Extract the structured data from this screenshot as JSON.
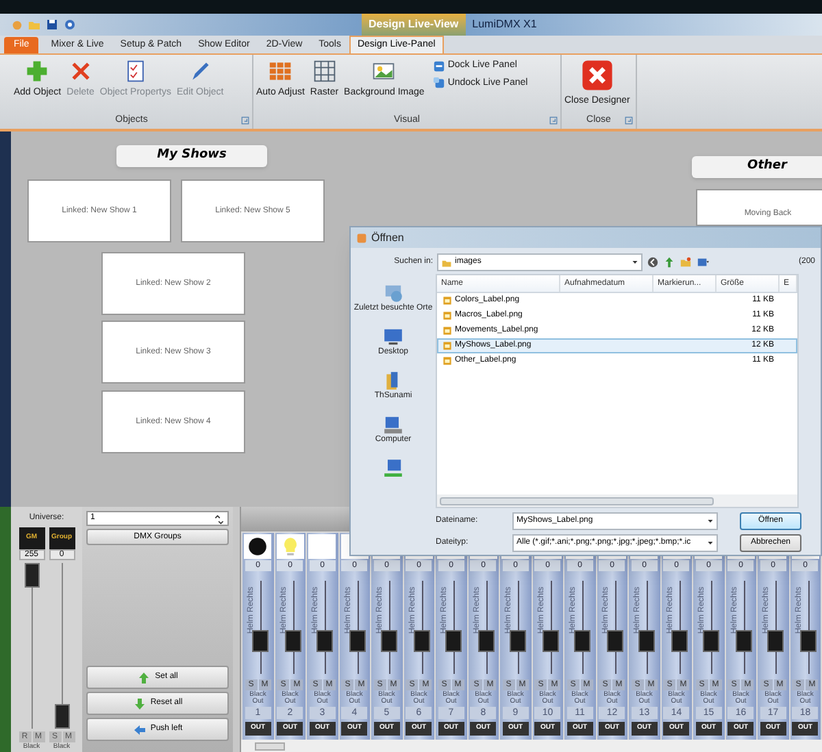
{
  "context_tab": "Design Live-View",
  "app_title": "LumiDMX X1",
  "tabs": [
    {
      "label": "File",
      "kind": "file",
      "selected": false
    },
    {
      "label": "Mixer & Live",
      "kind": "tab",
      "selected": false
    },
    {
      "label": "Setup & Patch",
      "kind": "tab",
      "selected": false
    },
    {
      "label": "Show Editor",
      "kind": "tab",
      "selected": false
    },
    {
      "label": "2D-View",
      "kind": "tab",
      "selected": false
    },
    {
      "label": "Tools",
      "kind": "tab",
      "selected": false
    },
    {
      "label": "Design Live-Panel",
      "kind": "tab",
      "selected": true
    }
  ],
  "ribbon_groups": [
    {
      "title": "Objects",
      "buttons": [
        {
          "label": "Add Object",
          "disabled": false
        },
        {
          "label": "Delete",
          "disabled": true
        },
        {
          "label": "Object Propertys",
          "disabled": true
        },
        {
          "label": "Edit Object",
          "disabled": true
        }
      ]
    },
    {
      "title": "Visual",
      "buttons": [
        {
          "label": "Auto Adjust",
          "disabled": false
        },
        {
          "label": "Raster",
          "disabled": false
        },
        {
          "label": "Background Image",
          "disabled": false
        }
      ],
      "small_buttons": [
        {
          "label": "Dock Live Panel"
        },
        {
          "label": "Undock Live Panel"
        }
      ]
    },
    {
      "title": "Close",
      "buttons": [
        {
          "label": "Close Designer",
          "disabled": false
        }
      ]
    }
  ],
  "canvas": {
    "headers": [
      {
        "title": "My Shows"
      },
      {
        "title": "Other"
      }
    ],
    "cards": [
      {
        "label": "Linked: New Show 1"
      },
      {
        "label": "Linked: New Show 5"
      },
      {
        "label": "Linked: New Show 2"
      },
      {
        "label": "Linked: New Show 3"
      },
      {
        "label": "Linked: New Show 4"
      },
      {
        "label": "Moving Back"
      }
    ]
  },
  "dialog": {
    "title": "Öffnen",
    "look_in_label": "Suchen in:",
    "look_in": "images",
    "side_text": "(200",
    "places": [
      {
        "label": "Zuletzt besuchte Orte"
      },
      {
        "label": "Desktop"
      },
      {
        "label": "ThSunami"
      },
      {
        "label": "Computer"
      }
    ],
    "columns": [
      "Name",
      "Aufnahmedatum",
      "Markierun...",
      "Größe",
      "E"
    ],
    "files": [
      {
        "name": "Colors_Label.png",
        "size": "11 KB",
        "selected": false
      },
      {
        "name": "Macros_Label.png",
        "size": "11 KB",
        "selected": false
      },
      {
        "name": "Movements_Label.png",
        "size": "12 KB",
        "selected": false
      },
      {
        "name": "MyShows_Label.png",
        "size": "12 KB",
        "selected": true
      },
      {
        "name": "Other_Label.png",
        "size": "11 KB",
        "selected": false
      }
    ],
    "filename_label": "Dateiname:",
    "filename": "MyShows_Label.png",
    "filetype_label": "Dateityp:",
    "filetype": "Alle (*.gif;*.ani;*.png;*.png;*.jpg;*.jpeg;*.bmp;*.ic",
    "buttons": [
      "Öffnen",
      "Abbrechen"
    ]
  },
  "mixer": {
    "universe_label": "Universe:",
    "universe": "1",
    "groups_button": "DMX Groups",
    "masters": [
      {
        "label": "GM",
        "value": "255",
        "level": 1,
        "buttons": [
          "R",
          "M"
        ],
        "footer": "Black"
      },
      {
        "label": "Group",
        "value": "0",
        "level": 0,
        "buttons": [
          "S",
          "M"
        ],
        "footer": "Black"
      }
    ],
    "actions": [
      "Set all",
      "Reset all",
      "Push left"
    ],
    "channels": [
      {
        "value": "0",
        "label": "Helm Rechts",
        "level": 0.35,
        "solo": "S",
        "mute": "M",
        "footer": "Black Out",
        "number": "1",
        "out": "OUT"
      },
      {
        "value": "0",
        "label": "Helm Rechts",
        "level": 0.35,
        "solo": "S",
        "mute": "M",
        "footer": "Black Out",
        "number": "2",
        "out": "OUT"
      },
      {
        "value": "0",
        "label": "Helm Rechts",
        "level": 0.35,
        "solo": "S",
        "mute": "M",
        "footer": "Black Out",
        "number": "3",
        "out": "OUT"
      },
      {
        "value": "0",
        "label": "Helm Rechts",
        "level": 0.35,
        "solo": "S",
        "mute": "M",
        "footer": "Black Out",
        "number": "4",
        "out": "OUT"
      },
      {
        "value": "0",
        "label": "Helm Rechts",
        "level": 0.35,
        "solo": "S",
        "mute": "M",
        "footer": "Black Out",
        "number": "5",
        "out": "OUT"
      },
      {
        "value": "0",
        "label": "Helm Rechts",
        "level": 0.35,
        "solo": "S",
        "mute": "M",
        "footer": "Black Out",
        "number": "6",
        "out": "OUT"
      },
      {
        "value": "0",
        "label": "Helm Rechts",
        "level": 0.35,
        "solo": "S",
        "mute": "M",
        "footer": "Black Out",
        "number": "7",
        "out": "OUT"
      },
      {
        "value": "0",
        "label": "Helm Rechts",
        "level": 0.35,
        "solo": "S",
        "mute": "M",
        "footer": "Black Out",
        "number": "8",
        "out": "OUT"
      },
      {
        "value": "0",
        "label": "Helm Rechts",
        "level": 0.35,
        "solo": "S",
        "mute": "M",
        "footer": "Black Out",
        "number": "9",
        "out": "OUT"
      },
      {
        "value": "0",
        "label": "Helm Rechts",
        "level": 0.35,
        "solo": "S",
        "mute": "M",
        "footer": "Black Out",
        "number": "10",
        "out": "OUT"
      },
      {
        "value": "0",
        "label": "Helm Rechts",
        "level": 0.35,
        "solo": "S",
        "mute": "M",
        "footer": "Black Out",
        "number": "11",
        "out": "OUT"
      },
      {
        "value": "0",
        "label": "Helm Rechts",
        "level": 0.35,
        "solo": "S",
        "mute": "M",
        "footer": "Black Out",
        "number": "12",
        "out": "OUT"
      },
      {
        "value": "0",
        "label": "Helm Rechts",
        "level": 0.35,
        "solo": "S",
        "mute": "M",
        "footer": "Black Out",
        "number": "13",
        "out": "OUT"
      },
      {
        "value": "0",
        "label": "Helm Rechts",
        "level": 0.35,
        "solo": "S",
        "mute": "M",
        "footer": "Black Out",
        "number": "14",
        "out": "OUT"
      },
      {
        "value": "0",
        "label": "Helm Rechts",
        "level": 0.35,
        "solo": "S",
        "mute": "M",
        "footer": "Black Out",
        "number": "15",
        "out": "OUT"
      },
      {
        "value": "0",
        "label": "Helm Rechts",
        "level": 0.35,
        "solo": "S",
        "mute": "M",
        "footer": "Black Out",
        "number": "16",
        "out": "OUT"
      },
      {
        "value": "0",
        "label": "Helm Rechts",
        "level": 0.35,
        "solo": "S",
        "mute": "M",
        "footer": "Black Out",
        "number": "17",
        "out": "OUT"
      },
      {
        "value": "0",
        "label": "Helm Rechts",
        "level": 0.35,
        "solo": "S",
        "mute": "M",
        "footer": "Black Out",
        "number": "18",
        "out": "OUT"
      }
    ]
  }
}
